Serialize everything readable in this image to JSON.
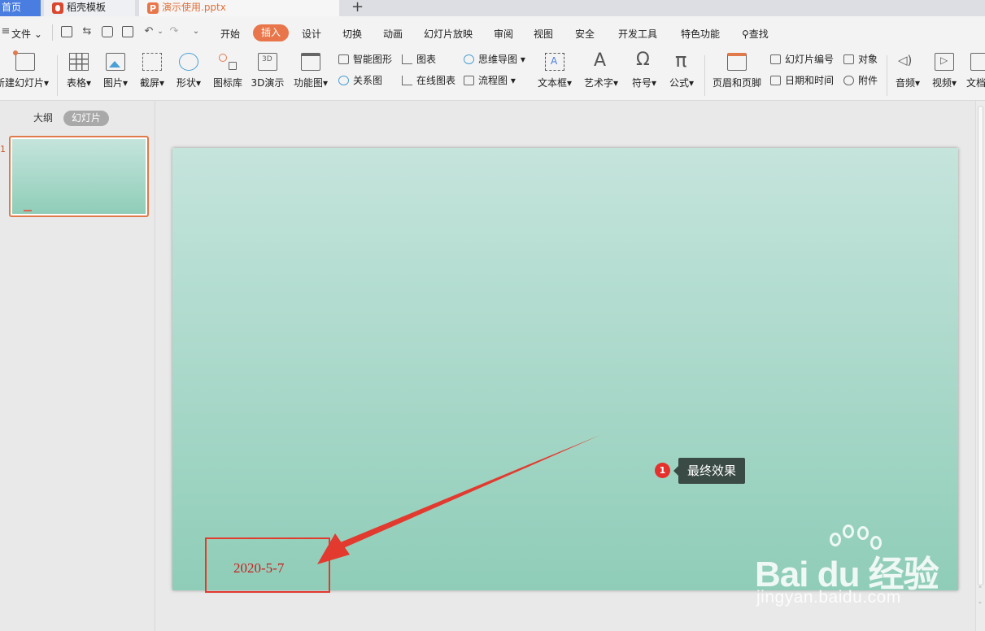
{
  "tabs": {
    "home": "首页",
    "templates": "稻壳模板",
    "document": "演示使用.pptx"
  },
  "menu": {
    "file": "文件",
    "items": [
      "开始",
      "插入",
      "设计",
      "切换",
      "动画",
      "幻灯片放映",
      "审阅",
      "视图",
      "安全",
      "开发工具",
      "特色功能"
    ],
    "active": "插入",
    "search": "查找"
  },
  "ribbon": {
    "new_slide": "新建幻灯片",
    "table": "表格",
    "picture": "图片",
    "screenshot": "截屏",
    "shape": "形状",
    "icon_library": "图标库",
    "3d": "3D演示",
    "function_chart": "功能图",
    "smart_shape": "智能图形",
    "chart": "图表",
    "mind_map": "思维导图",
    "relation_chart": "关系图",
    "online_chart": "在线图表",
    "flowchart": "流程图",
    "text_box": "文本框",
    "word_art": "艺术字",
    "symbol": "符号",
    "formula": "公式",
    "header_footer": "页眉和页脚",
    "slide_number": "幻灯片编号",
    "object": "对象",
    "date_time": "日期和时间",
    "attachment": "附件",
    "audio": "音频",
    "video": "视频",
    "document": "文档"
  },
  "panel": {
    "outline": "大纲",
    "slides": "幻灯片",
    "slide_number": "1"
  },
  "slide": {
    "date": "2020-5-7"
  },
  "callout": {
    "badge": "1",
    "text": "最终效果"
  },
  "watermark": {
    "logo": "Bai du 经验",
    "url": "jingyan.baidu.com"
  },
  "colors": {
    "accent": "#e8764a",
    "slide_top": "#c5e4dc",
    "slide_bottom": "#8fcdb8",
    "annotation_red": "#e23a2f"
  }
}
